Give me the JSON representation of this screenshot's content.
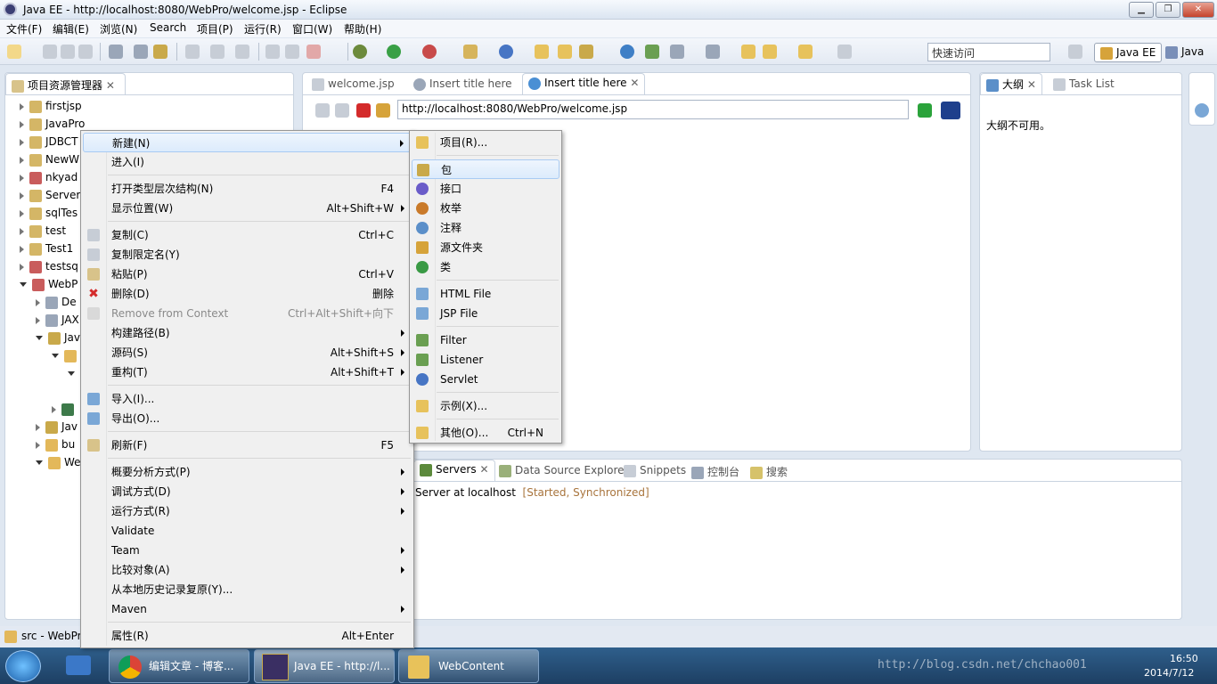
{
  "window": {
    "title": "Java EE - http://localhost:8080/WebPro/welcome.jsp - Eclipse",
    "btn_min": "▁",
    "btn_max": "❐",
    "btn_close": "✕"
  },
  "menubar": [
    "文件(F)",
    "编辑(E)",
    "浏览(N)",
    "Search",
    "项目(P)",
    "运行(R)",
    "窗口(W)",
    "帮助(H)"
  ],
  "toolbar": {
    "quick_access": "快速访问",
    "perspectives": [
      "Java EE",
      "Java"
    ]
  },
  "project_explorer": {
    "title": "项目资源管理器",
    "items": [
      "firstjsp",
      "JavaPro",
      "JDBCT",
      "NewW",
      "nkyad",
      "Server",
      "sqlTes",
      "test",
      "Test1",
      "testsq",
      "WebP",
      "De",
      "JAX",
      "Jav",
      "Jav",
      "bu",
      "We"
    ]
  },
  "editor": {
    "tabs": [
      "welcome.jsp",
      "Insert title here",
      "Insert title here"
    ],
    "url": "http://localhost:8080/WebPro/welcome.jsp"
  },
  "outline": {
    "tabs": [
      "大纲",
      "Task List"
    ],
    "message": "大纲不可用。"
  },
  "bottom": {
    "tabs": [
      "Servers",
      "Data Source Explorer",
      "Snippets",
      "控制台",
      "搜索"
    ],
    "server": "Server at localhost",
    "server_state": "[Started, Synchronized]"
  },
  "context_menu": {
    "items": [
      {
        "label": "新建(N)",
        "acc": "",
        "sub": true
      },
      {
        "label": "进入(I)",
        "acc": ""
      },
      {
        "label": "打开类型层次结构(N)",
        "acc": "F4"
      },
      {
        "label": "显示位置(W)",
        "acc": "Alt+Shift+W",
        "sub": true
      },
      {
        "label": "复制(C)",
        "acc": "Ctrl+C"
      },
      {
        "label": "复制限定名(Y)",
        "acc": ""
      },
      {
        "label": "粘贴(P)",
        "acc": "Ctrl+V"
      },
      {
        "label": "删除(D)",
        "acc": "删除"
      },
      {
        "label": "Remove from Context",
        "acc": "Ctrl+Alt+Shift+向下"
      },
      {
        "label": "构建路径(B)",
        "acc": "",
        "sub": true
      },
      {
        "label": "源码(S)",
        "acc": "Alt+Shift+S",
        "sub": true
      },
      {
        "label": "重构(T)",
        "acc": "Alt+Shift+T",
        "sub": true
      },
      {
        "label": "导入(I)...",
        "acc": ""
      },
      {
        "label": "导出(O)...",
        "acc": ""
      },
      {
        "label": "刷新(F)",
        "acc": "F5"
      },
      {
        "label": "概要分析方式(P)",
        "acc": "",
        "sub": true
      },
      {
        "label": "调试方式(D)",
        "acc": "",
        "sub": true
      },
      {
        "label": "运行方式(R)",
        "acc": "",
        "sub": true
      },
      {
        "label": "Validate",
        "acc": ""
      },
      {
        "label": "Team",
        "acc": "",
        "sub": true
      },
      {
        "label": "比较对象(A)",
        "acc": "",
        "sub": true
      },
      {
        "label": "从本地历史记录复原(Y)...",
        "acc": ""
      },
      {
        "label": "Maven",
        "acc": "",
        "sub": true
      },
      {
        "label": "属性(R)",
        "acc": "Alt+Enter"
      }
    ]
  },
  "submenu": {
    "items": [
      {
        "label": "项目(R)...",
        "acc": ""
      },
      {
        "label": "包",
        "acc": ""
      },
      {
        "label": "接口",
        "acc": ""
      },
      {
        "label": "枚举",
        "acc": ""
      },
      {
        "label": "注释",
        "acc": ""
      },
      {
        "label": "源文件夹",
        "acc": ""
      },
      {
        "label": "类",
        "acc": ""
      },
      {
        "label": "HTML File",
        "acc": ""
      },
      {
        "label": "JSP File",
        "acc": ""
      },
      {
        "label": "Filter",
        "acc": ""
      },
      {
        "label": "Listener",
        "acc": ""
      },
      {
        "label": "Servlet",
        "acc": ""
      },
      {
        "label": "示例(X)...",
        "acc": ""
      },
      {
        "label": "其他(O)...",
        "acc": "Ctrl+N"
      }
    ]
  },
  "status": {
    "text": "src - WebPro"
  },
  "taskbar": {
    "items": [
      "编辑文章 - 博客...",
      "Java EE - http://l...",
      "WebContent"
    ],
    "time": "16:50",
    "date": "2014/7/12",
    "watermark": "http://blog.csdn.net/chchao001"
  }
}
